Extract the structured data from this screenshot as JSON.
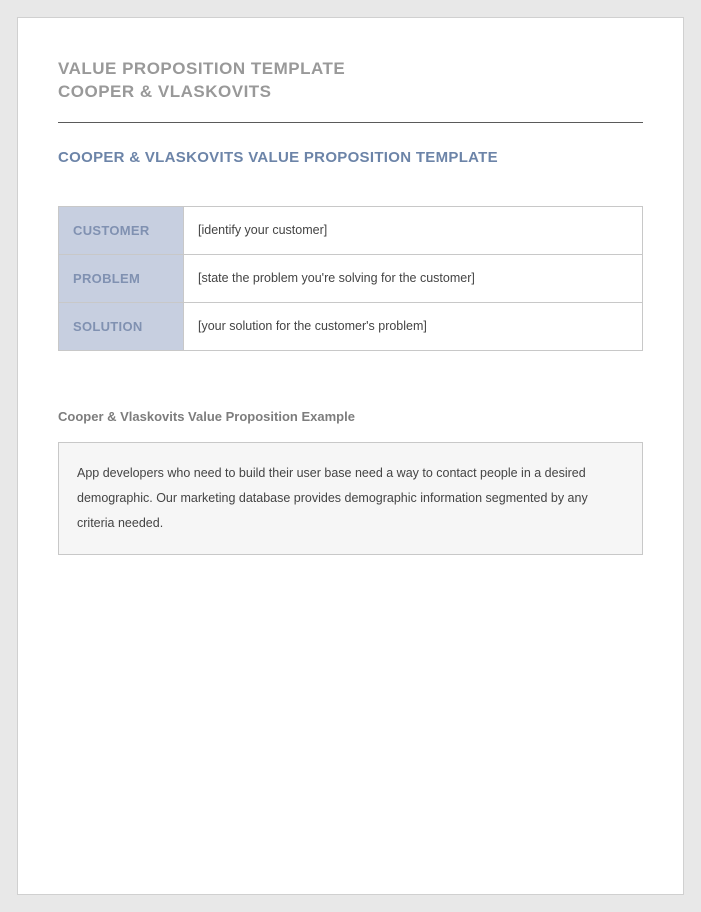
{
  "header": {
    "line1": "VALUE PROPOSITION TEMPLATE",
    "line2": "COOPER & VLASKOVITS"
  },
  "section_title": "COOPER & VLASKOVITS VALUE PROPOSITION TEMPLATE",
  "table": {
    "customer": {
      "label": "CUSTOMER",
      "value": "[identify your customer]"
    },
    "problem": {
      "label": "PROBLEM",
      "value": "[state the problem you're solving for the customer]"
    },
    "solution": {
      "label": "SOLUTION",
      "value": "[your solution for the customer's problem]"
    }
  },
  "example": {
    "title": "Cooper & Vlaskovits Value Proposition Example",
    "text": "App developers who need to build their user base need a way to contact people in a desired demographic. Our marketing database provides demographic information segmented by any criteria needed."
  }
}
